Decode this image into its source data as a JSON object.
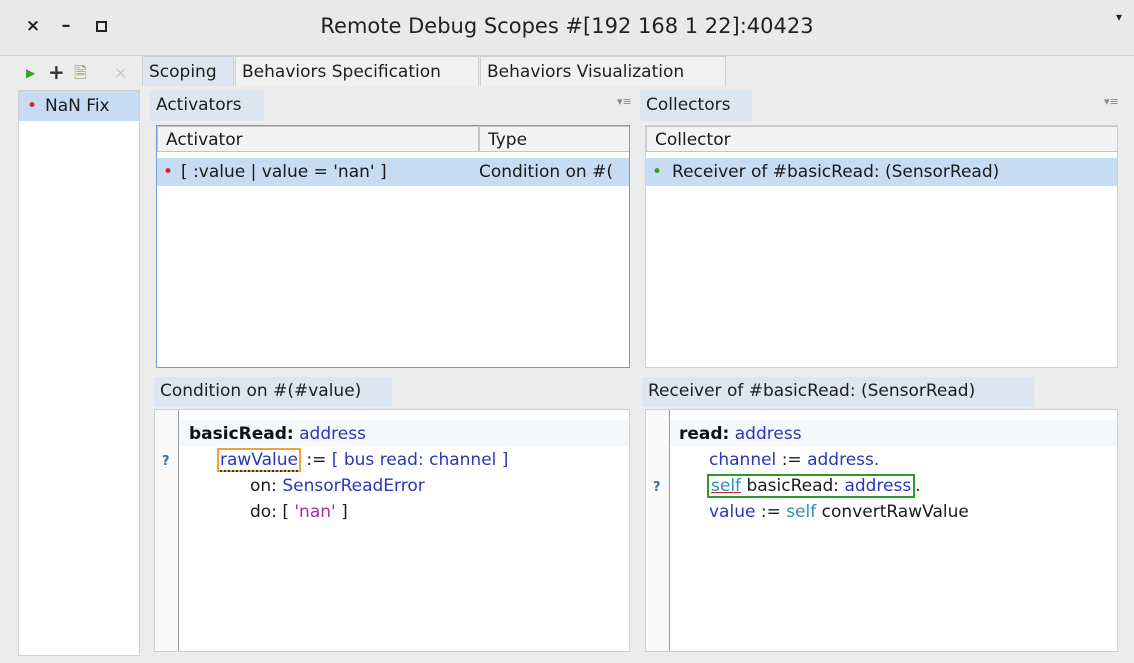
{
  "window": {
    "title": "Remote Debug Scopes #[192 168 1 22]:40423",
    "close_icon": "×",
    "minimize_icon": "–",
    "menu_icon": "▾"
  },
  "toolbar": {
    "play_icon": "▶",
    "add_icon": "+",
    "edit_icon": "🗎",
    "remove_icon": "×"
  },
  "tabs": [
    {
      "label": "Scoping",
      "active": true
    },
    {
      "label": "Behaviors Specification",
      "active": false
    },
    {
      "label": "Behaviors Visualization",
      "active": false
    }
  ],
  "scopes": {
    "items": [
      {
        "label": "NaN Fix"
      }
    ]
  },
  "activators": {
    "tab_label": "Activators",
    "menu_icon": "▾≡",
    "columns": [
      "Activator",
      "Type"
    ],
    "rows": [
      {
        "activator": "[ :value | value = 'nan' ]",
        "type": "Condition on #("
      }
    ]
  },
  "collectors": {
    "tab_label": "Collectors",
    "menu_icon": "▾≡",
    "columns": [
      "Collector"
    ],
    "rows": [
      {
        "collector": "Receiver of #basicRead: (SensorRead)"
      }
    ]
  },
  "condition_editor": {
    "tab_label": "Condition on #(#value)",
    "marker": "?",
    "code": {
      "selector": "basicRead:",
      "arg": "address",
      "var": "rawValue",
      "assign": ":=",
      "open_block": "[",
      "recv": "bus",
      "msg": "read:",
      "msg_arg": "channel",
      "close_block": "]",
      "on_kw": "on:",
      "on_arg": "SensorReadError",
      "do_kw": "do: [",
      "str": "'nan'",
      "do_close": "]"
    }
  },
  "receiver_editor": {
    "tab_label": "Receiver of #basicRead: (SensorRead)",
    "marker": "?",
    "code": {
      "selector": "read:",
      "arg": "address",
      "l2_var": "channel",
      "l2_assign": ":=",
      "l2_val": "address.",
      "l3_self": "self",
      "l3_msg": "basicRead:",
      "l3_arg": "address",
      "l3_dot": ".",
      "l4_var": "value",
      "l4_assign": ":=",
      "l4_self": "self",
      "l4_msg": "convertRawValue"
    }
  },
  "colors": {
    "selection": "#c6dcf2",
    "keyword_blue": "#2a36b8",
    "self_teal": "#2a8fb8",
    "string_pink": "#a22ea6",
    "highlight_orange": "#f0a23c",
    "highlight_green": "#2e9a2e"
  }
}
